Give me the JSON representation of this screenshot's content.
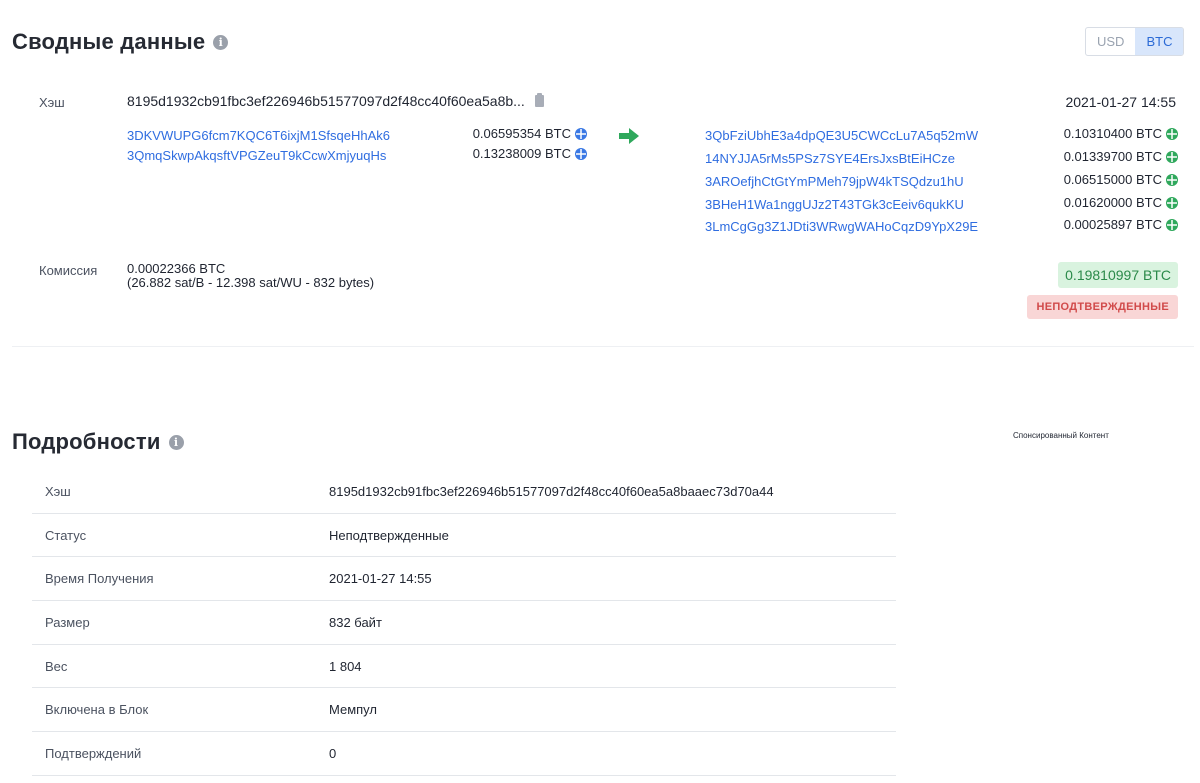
{
  "summary": {
    "title": "Сводные данные",
    "currency_toggle": {
      "options": [
        "USD",
        "BTC"
      ],
      "selected": "BTC"
    },
    "hash_label": "Хэш",
    "hash_short": "8195d1932cb91fbc3ef226946b51577097d2f48cc40f60ea5a8b...",
    "time": "2021-01-27 14:55",
    "inputs": [
      {
        "address": "3DKVWUPG6fcm7KQC6T6ixjM1SfsqeHhAk6",
        "amount": "0.06595354 BTC"
      },
      {
        "address": "3QmqSkwpAkqsftVPGZeuT9kCcwXmjyuqHs",
        "amount": "0.13238009 BTC"
      }
    ],
    "outputs": [
      {
        "address": "3QbFziUbhE3a4dpQE3U5CWCcLu7A5q52mW",
        "amount": "0.10310400 BTC"
      },
      {
        "address": "14NYJJA5rMs5PSz7SYE4ErsJxsBtEiHCze",
        "amount": "0.01339700 BTC"
      },
      {
        "address": "3AROefjhCtGtYmPMeh79jpW4kTSQdzu1hU",
        "amount": "0.06515000 BTC"
      },
      {
        "address": "3BHeH1Wa1nggUJz2T43TGk3cEeiv6qukKU",
        "amount": "0.01620000 BTC"
      },
      {
        "address": "3LmCgGg3Z1JDti3WRwgWAHoCqzD9YpX29E",
        "amount": "0.00025897 BTC"
      }
    ],
    "fee_label": "Комиссия",
    "fee_value": "0.00022366 BTC",
    "fee_detail": "(26.882 sat/B - 12.398 sat/WU - 832 bytes)",
    "total": "0.19810997 BTC",
    "status_badge": "НЕПОДТВЕРЖДЕННЫЕ",
    "colors": {
      "link": "#2f6de0",
      "green": "#2fa85c",
      "red_badge": "#d14a4a"
    }
  },
  "details": {
    "title": "Подробности",
    "sponsored": "Спонсированный Контент",
    "rows": [
      {
        "key": "Хэш",
        "value": "8195d1932cb91fbc3ef226946b51577097d2f48cc40f60ea5a8baaec73d70a44"
      },
      {
        "key": "Статус",
        "value": "Неподтвержденные"
      },
      {
        "key": "Время Получения",
        "value": "2021-01-27 14:55"
      },
      {
        "key": "Размер",
        "value": "832 байт"
      },
      {
        "key": "Вес",
        "value": "1 804"
      },
      {
        "key": "Включена в Блок",
        "value": "Мемпул"
      },
      {
        "key": "Подтверждений",
        "value": "0"
      }
    ]
  },
  "icons": [
    "info-icon",
    "clipboard-icon",
    "globe-icon",
    "arrow-right-icon"
  ]
}
